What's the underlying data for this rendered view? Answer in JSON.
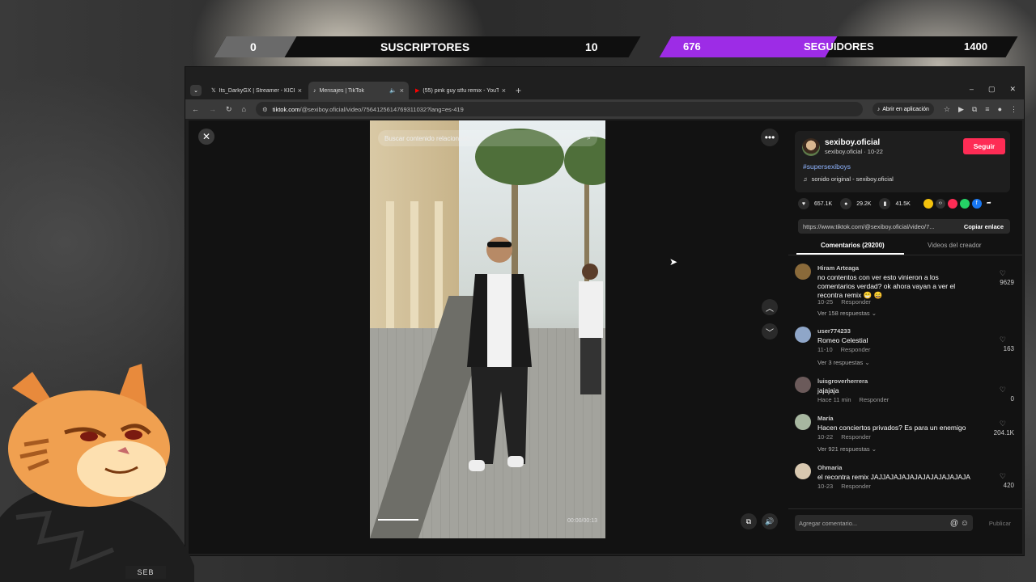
{
  "counters": {
    "subscribers": {
      "current": "0",
      "label": "SUSCRIPTORES",
      "goal": "10",
      "progress": 0.0,
      "color": "#6a6a6a"
    },
    "followers": {
      "current": "676",
      "label": "SEGUIDORES",
      "goal": "1400",
      "progress": 0.48,
      "color": "#9d2ce6"
    }
  },
  "browser": {
    "tabs": [
      {
        "label": "Its_DarkyGX | Streamer - KICK",
        "icon": "x-icon",
        "active": false
      },
      {
        "label": "Mensajes | TikTok",
        "icon": "tiktok-icon",
        "active": true
      },
      {
        "label": "(55) pink guy stfu remix - YouT...",
        "icon": "youtube-icon",
        "active": false
      }
    ],
    "url_host": "tiktok.com",
    "url_path": "/@sexiboy.oficial/video/7564125614769311032?lang=es-419",
    "open_app_label": "Abrir en aplicación"
  },
  "video": {
    "search_placeholder": "Buscar contenido relacionado",
    "time": "00:00/00:13"
  },
  "post": {
    "username": "sexiboy.oficial",
    "subline": "sexiboy.oficial · 10-22",
    "follow_label": "Seguir",
    "hashtag": "#supersexiboys",
    "sound": "sonido original - sexiboy.oficial",
    "likes": "657.1K",
    "comments_count": "29.2K",
    "saves": "41.5K",
    "link": "https://www.tiktok.com/@sexiboy.oficial/video/7...",
    "copy_label": "Copiar enlace",
    "tab_comments": "Comentarios (29200)",
    "tab_videos": "Videos del creador"
  },
  "comments": [
    {
      "user": "Hiram Arteaga",
      "text": "no contentos con ver esto vinieron a los comentarios verdad? ok ahora vayan a ver el recontra remix 😁 😄",
      "date": "10-25",
      "reply": "Responder",
      "replies": "Ver 158 respuestas",
      "likes": "9629"
    },
    {
      "user": "user774233",
      "text": "Romeo Celestial",
      "date": "11-10",
      "reply": "Responder",
      "replies": "Ver 3 respuestas",
      "likes": "163"
    },
    {
      "user": "luisgroverherrera",
      "text": "jajajaja",
      "date": "Hace 11 min",
      "reply": "Responder",
      "replies": "",
      "likes": "0"
    },
    {
      "user": "María",
      "text": "Hacen conciertos privados? Es para un enemigo",
      "date": "10-22",
      "reply": "Responder",
      "replies": "Ver 921 respuestas",
      "likes": "204.1K"
    },
    {
      "user": "Ohmaria",
      "text": "el recontra remix JAJJAJAJAJAJAJAJAJAJAJAJA",
      "date": "10-23",
      "reply": "Responder",
      "replies": "",
      "likes": "420"
    }
  ],
  "comment_input": {
    "placeholder": "Agregar comentario...",
    "publish_label": "Publicar"
  },
  "overlay": {
    "badge": "SEB"
  }
}
